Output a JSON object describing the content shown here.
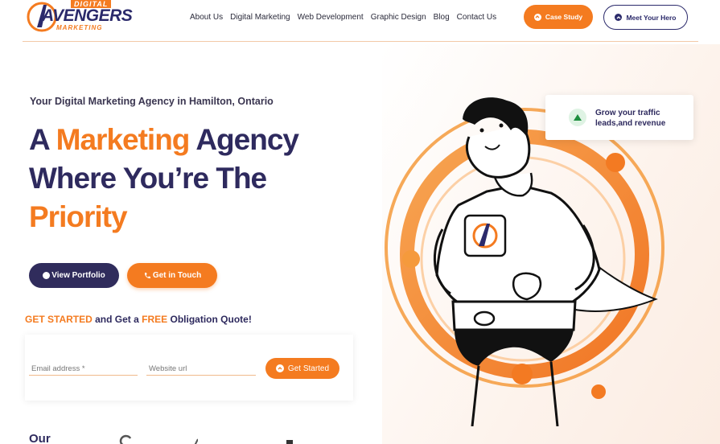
{
  "brand": {
    "logo_top": "DIGITAL",
    "logo_main": "AVENGERS",
    "logo_bottom": "MARKETING",
    "accent": "#f47b20",
    "navy": "#2e2a5e"
  },
  "nav": {
    "items": [
      "About Us",
      "Digital Marketing",
      "Web Development",
      "Graphic Design",
      "Blog",
      "Contact Us"
    ],
    "case_study_label": "Case Study",
    "meet_hero_label": "Meet Your Hero"
  },
  "hero": {
    "subtitle": "Your Digital Marketing Agency in Hamilton, Ontario",
    "headline_part1": "A ",
    "headline_orange1": "Marketing",
    "headline_part2": " Agency Where You’re The ",
    "headline_orange2": "Priority",
    "view_portfolio_label": "View Portfolio",
    "get_in_touch_label": "Get in Touch"
  },
  "quote": {
    "part1": "GET STARTED",
    "part2": " and Get a ",
    "part3": "FREE",
    "part4": " Obligation Quote!",
    "email_placeholder": "Email address *",
    "website_placeholder": "Website url",
    "submit_label": "Get Started"
  },
  "growth_card": {
    "text": "Grow your traffic leads,and revenue"
  },
  "partners": {
    "heading": "Our"
  }
}
